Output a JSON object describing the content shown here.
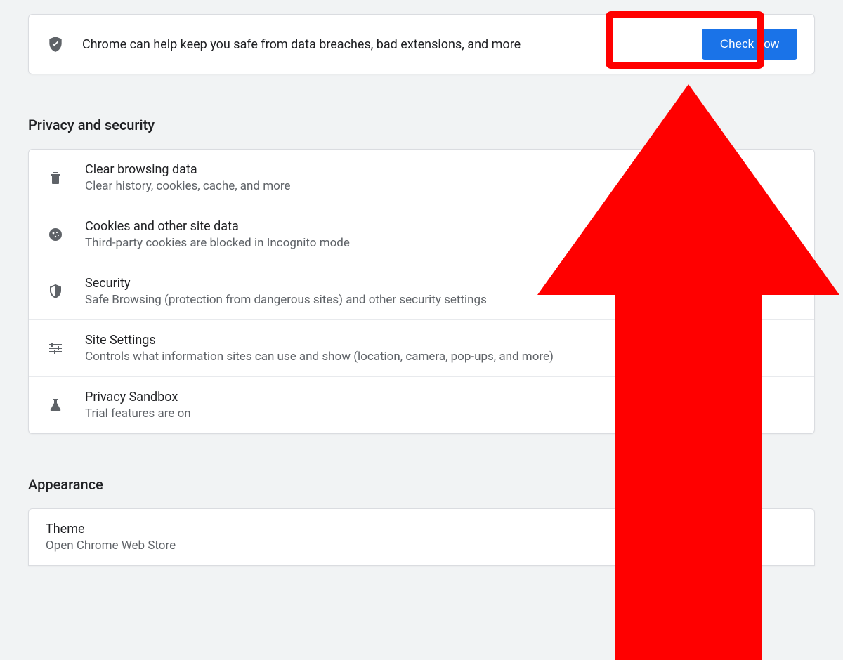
{
  "safety": {
    "text": "Chrome can help keep you safe from data breaches, bad extensions, and more",
    "button_label": "Check now"
  },
  "privacy": {
    "heading": "Privacy and security",
    "items": [
      {
        "title": "Clear browsing data",
        "desc": "Clear history, cookies, cache, and more"
      },
      {
        "title": "Cookies and other site data",
        "desc": "Third-party cookies are blocked in Incognito mode"
      },
      {
        "title": "Security",
        "desc": "Safe Browsing (protection from dangerous sites) and other security settings"
      },
      {
        "title": "Site Settings",
        "desc": "Controls what information sites can use and show (location, camera, pop-ups, and more)"
      },
      {
        "title": "Privacy Sandbox",
        "desc": "Trial features are on"
      }
    ]
  },
  "appearance": {
    "heading": "Appearance",
    "theme_title": "Theme",
    "theme_desc": "Open Chrome Web Store"
  }
}
